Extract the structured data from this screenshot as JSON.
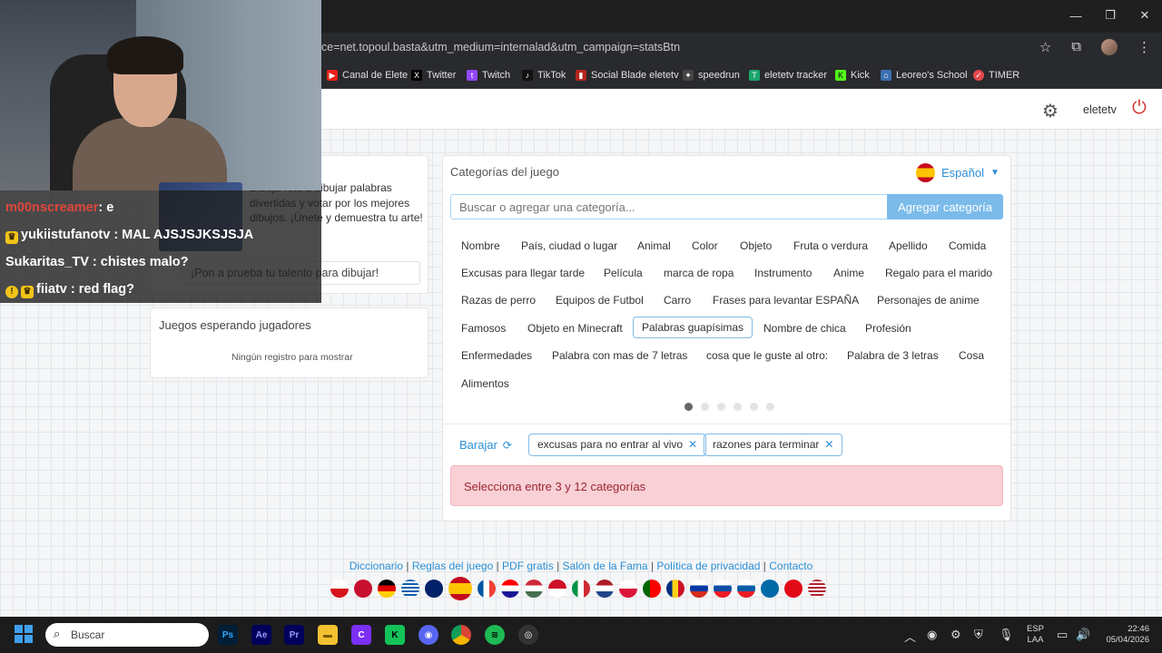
{
  "browser": {
    "url": "ce=net.topoul.basta&utm_medium=internalad&utm_campaign=statsBtn",
    "bookmarks": [
      "Canal de Elete",
      "Twitter",
      "Twitch",
      "TikTok",
      "Social Blade eletetv",
      "speedrun",
      "eletetv tracker",
      "Kick",
      "Leoreo's School",
      "TIMER"
    ]
  },
  "header": {
    "username": "eletetv"
  },
  "left": {
    "intro": "Dibuja reta a dibujar palabras divertidas y votar por los mejores dibujos. ¡Únete y demuestra tu arte!",
    "input_value": "¡Pon a prueba tu talento para dibujar!",
    "waiting_title": "Juegos esperando jugadores",
    "waiting_empty": "Ningún registro para mostrar"
  },
  "categories_panel": {
    "title": "Categorías del juego",
    "language": "Español",
    "search_placeholder": "Buscar o agregar una categoría...",
    "add_button": "Agregar categoría",
    "items": [
      "Nombre",
      "País, ciudad o lugar",
      "Animal",
      "Color",
      "Objeto",
      "Fruta o verdura",
      "Apellido",
      "Comida",
      "Excusas para llegar tarde",
      "Película",
      "marca de ropa",
      "Instrumento",
      "Anime",
      "Regalo para el marido",
      "Razas de perro",
      "Equipos de Futbol",
      "Carro",
      "Frases para levantar ESPAÑA",
      "Personajes de anime",
      "Famosos",
      "Objeto en Minecraft",
      "Palabras guapísimas",
      "Nombre de chica",
      "Profesión",
      "Enfermedades",
      "Palabra con mas de 7 letras",
      "cosa que le guste al otro:",
      "Palabra de 3 letras",
      "Cosa",
      "Alimentos"
    ],
    "shuffle_label": "Barajar",
    "selected_tags": [
      "excusas para no entrar al vivo",
      "razones para terminar"
    ],
    "alert": "Selecciona entre 3 y 12 categorías"
  },
  "footer": {
    "links": [
      "Diccionario",
      "Reglas del juego",
      "PDF gratis",
      "Salón de la Fama",
      "Política de privacidad",
      "Contacto"
    ]
  },
  "chat": {
    "messages": [
      {
        "user": "m00nscreamer",
        "text": ": e",
        "color": "#e0463c"
      },
      {
        "user": "yukiistufanotv",
        "text": ": MAL AJSJSJKSJSJA",
        "color": "#ffffff"
      },
      {
        "user": "Sukaritas_TV",
        "text": ": chistes malo?",
        "color": "#ffffff"
      },
      {
        "user": "fiiatv",
        "text": ": red flag?",
        "color": "#ffffff"
      }
    ]
  },
  "taskbar": {
    "search_placeholder": "Buscar",
    "lang_top": "ESP",
    "lang_bottom": "LAA",
    "time": "22:46",
    "date": "05/04/2026"
  }
}
